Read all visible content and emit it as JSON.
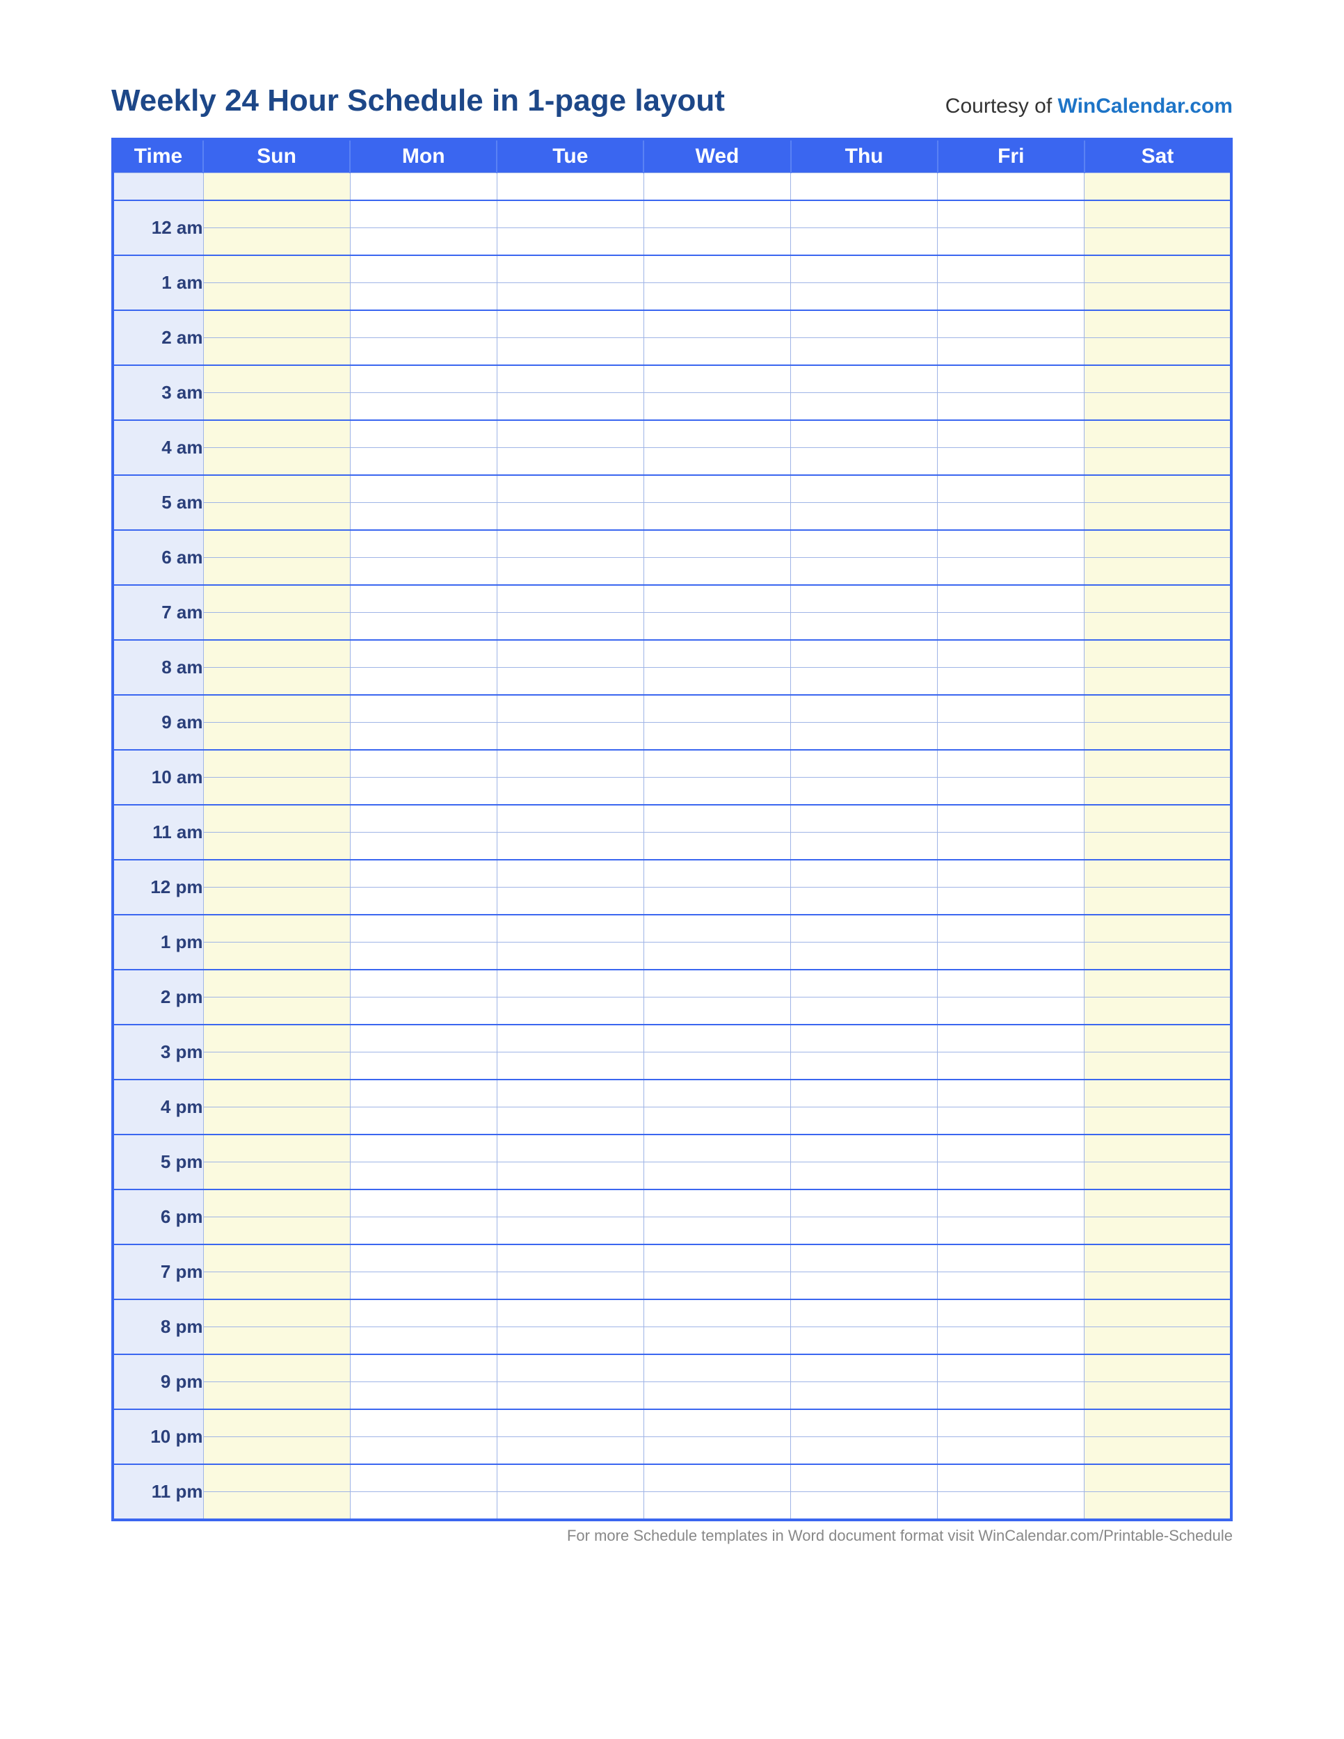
{
  "header": {
    "title": "Weekly 24 Hour Schedule in 1-page layout",
    "courtesy_prefix": "Courtesy of ",
    "courtesy_link": "WinCalendar.com"
  },
  "columns": {
    "time": "Time",
    "days": [
      "Sun",
      "Mon",
      "Tue",
      "Wed",
      "Thu",
      "Fri",
      "Sat"
    ]
  },
  "hours": [
    "12 am",
    "1 am",
    "2 am",
    "3 am",
    "4 am",
    "5 am",
    "6 am",
    "7 am",
    "8 am",
    "9 am",
    "10 am",
    "11 am",
    "12 pm",
    "1 pm",
    "2 pm",
    "3 pm",
    "4 pm",
    "5 pm",
    "6 pm",
    "7 pm",
    "8 pm",
    "9 pm",
    "10 pm",
    "11 pm"
  ],
  "footer": {
    "prefix": "For more Schedule templates in Word document format visit ",
    "link": "WinCalendar.com/Printable-Schedule"
  },
  "colors": {
    "header_bg": "#3a66f0",
    "time_col_bg": "#e6ecfa",
    "weekend_cell_bg": "#fbfadf",
    "weekday_cell_bg": "#ffffff",
    "title_color": "#1d4788",
    "link_color": "#1d74c7"
  }
}
